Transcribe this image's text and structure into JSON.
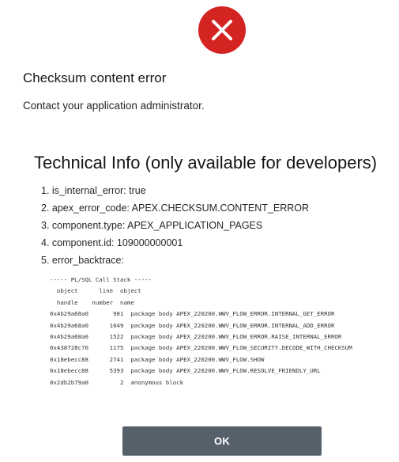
{
  "dialog": {
    "icon": "error-x-icon",
    "icon_color": "#d42421",
    "title": "Checksum content error",
    "message": "Contact your application administrator."
  },
  "technical_info": {
    "heading": "Technical Info (only available for developers)",
    "items": [
      "1. is_internal_error: true",
      "2. apex_error_code: APEX.CHECKSUM.CONTENT_ERROR",
      "3. component.type: APEX_APPLICATION_PAGES",
      "4. component.id: 109000000001",
      "5. error_backtrace:"
    ],
    "backtrace": "----- PL/SQL Call Stack -----\n  object      line  object\n  handle    number  name\n0x4b29a68a0       981  package body APEX_220200.WWV_FLOW_ERROR.INTERNAL_GET_ERROR\n0x4b29a68a0      1049  package body APEX_220200.WWV_FLOW_ERROR.INTERNAL_ADD_ERROR\n0x4b29a68a0      1522  package body APEX_220200.WWV_FLOW_ERROR.RAISE_INTERNAL_ERROR\n0x438728c70      1175  package body APEX_220200.WWV_FLOW_SECURITY.DECODE_WITH_CHECKSUM\n0x18ebecc88      2741  package body APEX_220200.WWV_FLOW.SHOW\n0x18ebecc88      5393  package body APEX_220200.WWV_FLOW.RESOLVE_FRIENDLY_URL\n0x2db2b79a0         2  anonymous block"
  },
  "actions": {
    "ok_label": "OK",
    "ok_color": "#56606b"
  }
}
